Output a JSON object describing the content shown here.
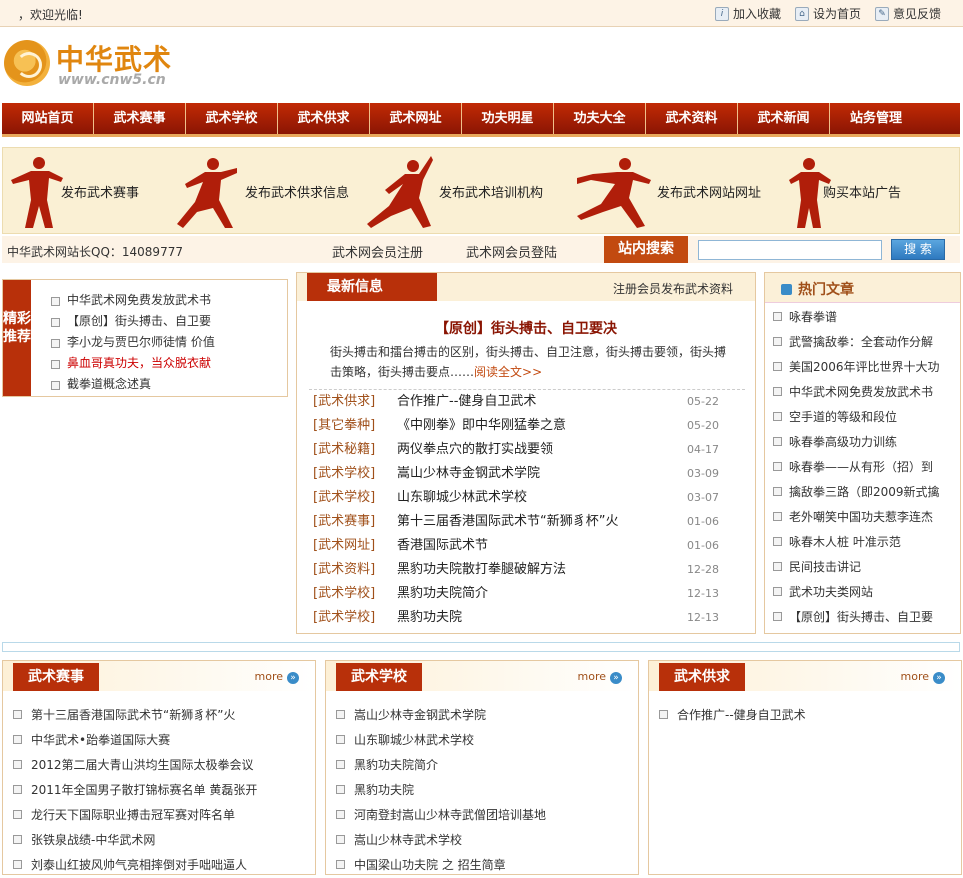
{
  "topbar": {
    "welcome": "，欢迎光临!",
    "links": [
      {
        "label": "加入收藏",
        "icon": "bookmark-icon"
      },
      {
        "label": "设为首页",
        "icon": "home-icon"
      },
      {
        "label": "意见反馈",
        "icon": "feedback-icon"
      }
    ]
  },
  "logo": {
    "title": "中华武术",
    "url": "www.cnw5.cn"
  },
  "nav": [
    "网站首页",
    "武术赛事",
    "武术学校",
    "武术供求",
    "武术网址",
    "功夫明星",
    "功夫大全",
    "武术资料",
    "武术新闻",
    "站务管理"
  ],
  "banner": [
    "发布武术赛事",
    "发布武术供求信息",
    "发布武术培训机构",
    "发布武术网站网址",
    "购买本站广告"
  ],
  "strip": {
    "qq": "中华武术网站长QQ：14089777",
    "register": "武术网会员注册",
    "login": "武术网会员登陆",
    "search_label": "站内搜索",
    "search_value": "",
    "search_button": "搜 索"
  },
  "recommend": {
    "tag": "精彩推荐",
    "items": [
      {
        "text": "中华武术网免费发放武术书",
        "color": "#333333"
      },
      {
        "text": "【原创】街头搏击、自卫要",
        "color": "#333333"
      },
      {
        "text": "李小龙与贾巴尔师徒情 价值",
        "color": "#333333"
      },
      {
        "text": "鼻血哥真功夫，当众脱衣献",
        "color": "#cc0000"
      },
      {
        "text": "截拳道概念述真",
        "color": "#333333"
      }
    ]
  },
  "news": {
    "title": "最新信息",
    "right_link": "注册会员发布武术资料",
    "featured_title": "【原创】街头搏击、自卫要决",
    "featured_desc": "街头搏击和擂台搏击的区别，街头搏击、自卫注意，街头搏击要领，街头搏击策略，街头搏击要点……",
    "featured_more": "阅读全文>>",
    "items": [
      {
        "cat": "[武术供求]",
        "title": "合作推广--健身自卫武术",
        "date": "05-22"
      },
      {
        "cat": "[其它拳种]",
        "title": "《中刚拳》即中华刚猛拳之意",
        "date": "05-20"
      },
      {
        "cat": "[武术秘籍]",
        "title": "两仪拳点穴的散打实战要领",
        "date": "04-17"
      },
      {
        "cat": "[武术学校]",
        "title": "嵩山少林寺金钢武术学院",
        "date": "03-09"
      },
      {
        "cat": "[武术学校]",
        "title": "山东聊城少林武术学校",
        "date": "03-07"
      },
      {
        "cat": "[武术赛事]",
        "title": "第十三届香港国际武术节“新狮豸杯”火",
        "date": "01-06"
      },
      {
        "cat": "[武术网址]",
        "title": "香港国际武术节",
        "date": "01-06"
      },
      {
        "cat": "[武术资料]",
        "title": "黑豹功夫院散打拳腿破解方法",
        "date": "12-28"
      },
      {
        "cat": "[武术学校]",
        "title": "黑豹功夫院简介",
        "date": "12-13"
      },
      {
        "cat": "[武术学校]",
        "title": "黑豹功夫院",
        "date": "12-13"
      }
    ]
  },
  "hot": {
    "title": "热门文章",
    "items": [
      "咏春拳谱",
      "武警擒敌拳：全套动作分解",
      "美国2006年评比世界十大功",
      "中华武术网免费发放武术书",
      "空手道的等级和段位",
      "咏春拳高级功力训练",
      "咏春拳——从有形（招）到",
      "擒敌拳三路（即2009新式擒",
      "老外嘲笑中国功夫惹李连杰",
      "咏春木人桩 叶准示范",
      "民间技击讲记",
      "武术功夫类网站",
      "【原创】街头搏击、自卫要"
    ]
  },
  "boxes": [
    {
      "title": "武术赛事",
      "more": "more",
      "items": [
        "第十三届香港国际武术节“新狮豸杯”火",
        "中华武术•跆拳道国际大赛",
        "2012第二届大青山洪均生国际太极拳会议",
        "2011年全国男子散打锦标赛名单 黄磊张开",
        "龙行天下国际职业搏击冠军赛对阵名单",
        "张铁泉战绩-中华武术网",
        "刘泰山红披风帅气亮相摔倒对手咄咄逼人"
      ]
    },
    {
      "title": "武术学校",
      "more": "more",
      "items": [
        "嵩山少林寺金钢武术学院",
        "山东聊城少林武术学校",
        "黑豹功夫院简介",
        "黑豹功夫院",
        "河南登封嵩山少林寺武僧团培训基地",
        "嵩山少林寺武术学校",
        "中国梁山功夫院 之 招生简章"
      ]
    },
    {
      "title": "武术供求",
      "more": "more",
      "items": [
        "合作推广--健身自卫武术"
      ]
    }
  ]
}
